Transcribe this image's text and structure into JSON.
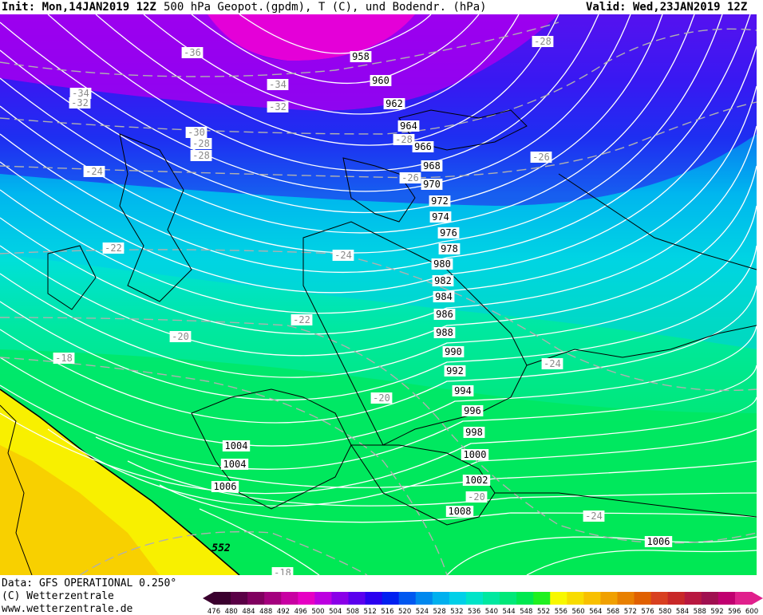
{
  "header": {
    "init": "Init: Mon,14JAN2019 12Z",
    "title": "500 hPa Geopot.(gpdm), T (C), und Bodendr. (hPa)",
    "valid": "Valid: Wed,23JAN2019 12Z"
  },
  "footer": {
    "data": "Data: GFS OPERATIONAL 0.250°",
    "copyright": "(C) Wetterzentrale",
    "url": "www.wetterzentrale.de"
  },
  "geopotential_label": "552",
  "pressure_labels": [
    "958",
    "960",
    "962",
    "964",
    "966",
    "968",
    "970",
    "972",
    "974",
    "976",
    "978",
    "980",
    "982",
    "984",
    "986",
    "988",
    "990",
    "992",
    "994",
    "996",
    "998",
    "1000",
    "1002",
    "1004",
    "1004",
    "1006",
    "1008",
    "1006",
    "1004"
  ],
  "temperature_labels": [
    "-36",
    "-34",
    "-34",
    "-32",
    "-32",
    "-30",
    "-28",
    "-28",
    "-28",
    "-28",
    "-26",
    "-26",
    "-24",
    "-22",
    "-24",
    "-22",
    "-20",
    "-18",
    "-20",
    "-20",
    "-24",
    "-24",
    "-18"
  ],
  "colorbar": {
    "ticks": [
      "476",
      "480",
      "484",
      "488",
      "492",
      "496",
      "500",
      "504",
      "508",
      "512",
      "516",
      "520",
      "524",
      "528",
      "532",
      "536",
      "540",
      "544",
      "548",
      "552",
      "556",
      "560",
      "564",
      "568",
      "572",
      "576",
      "580",
      "584",
      "588",
      "592",
      "596",
      "600"
    ],
    "colors": [
      "#3a002e",
      "#5a0046",
      "#80005f",
      "#a4007e",
      "#c800a2",
      "#e600c4",
      "#bc00e0",
      "#8a00e8",
      "#5a00ee",
      "#2a00f0",
      "#0020f0",
      "#0058f0",
      "#0088ee",
      "#00b0ee",
      "#00d0e8",
      "#00e4c8",
      "#00e8a0",
      "#00e878",
      "#00e850",
      "#20f020",
      "#f8f800",
      "#f8dc00",
      "#f8c000",
      "#f0a000",
      "#e88000",
      "#e06000",
      "#d84020",
      "#c82828",
      "#b81840",
      "#a01050",
      "#c00070",
      "#e0208c"
    ]
  }
}
